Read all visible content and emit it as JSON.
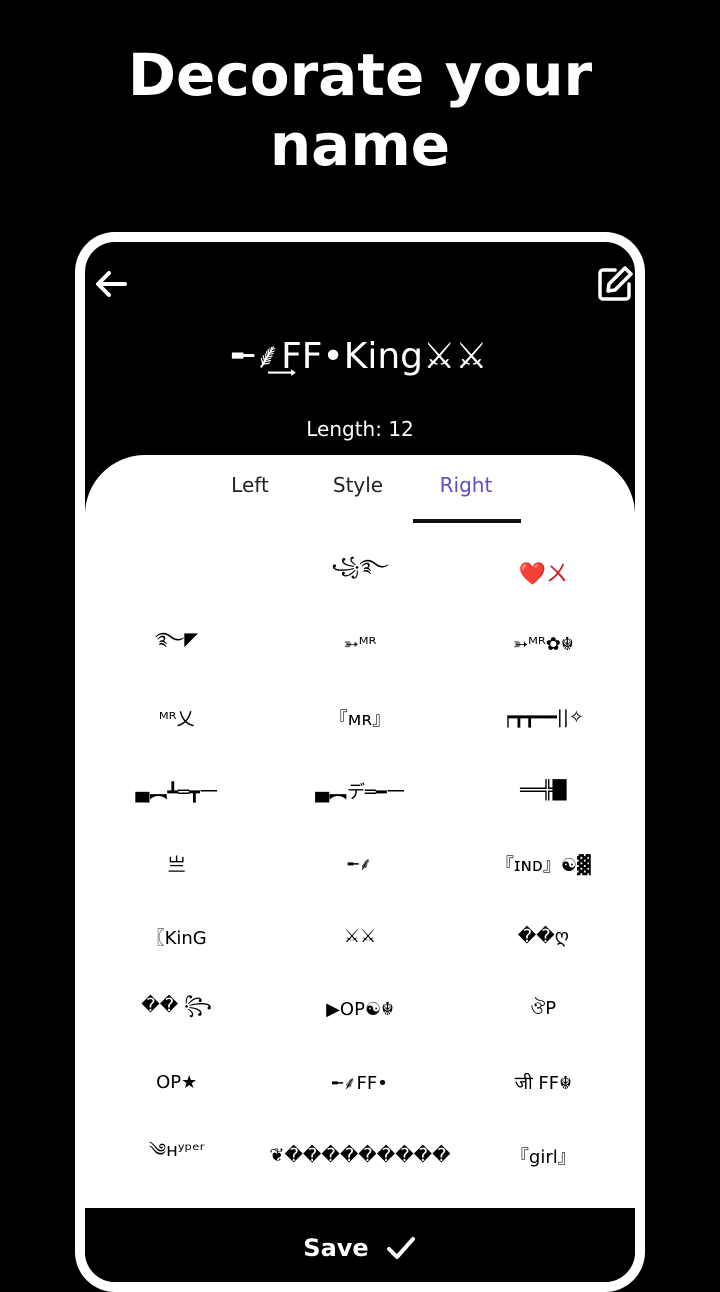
{
  "headline": {
    "line1": "Decorate your",
    "line2": "name"
  },
  "header": {
    "back_icon": "arrow-left-icon",
    "edit_icon": "edit-icon",
    "decorated_name": "╾⸙͢FF•King⚔⚔",
    "length_text": "Length: 12"
  },
  "tabs": [
    {
      "label": "Left",
      "active": false
    },
    {
      "label": "Style",
      "active": false
    },
    {
      "label": "Right",
      "active": true
    }
  ],
  "accent_color": "#5b4ec9",
  "symbols": [
    "",
    "꧁࿐",
    "❤️ㄨ",
    "࿐◤",
    "➳ᴹᴿ",
    "➳ᴹᴿ✿☬",
    "ᴹᴿ乂",
    "『ᴍʀ』",
    "┍┳┳━━||✧",
    "▄︻┻═┳一",
    "▄︻デ═━一",
    "══╬█",
    "亗",
    "╾⸙",
    "『ɪɴᴅ』☯▓",
    "〖KinG",
    "⚔⚔",
    "��ღ",
    "�� ꧂",
    "▶OP☯☬",
    "ঔP",
    "OP★",
    "╾⸙FF•",
    "जी FF☬",
    "༄ʜʸᵖᵉʳ",
    "❦���������",
    "『girl』"
  ],
  "save_label": "Save",
  "save_icon": "check-icon"
}
